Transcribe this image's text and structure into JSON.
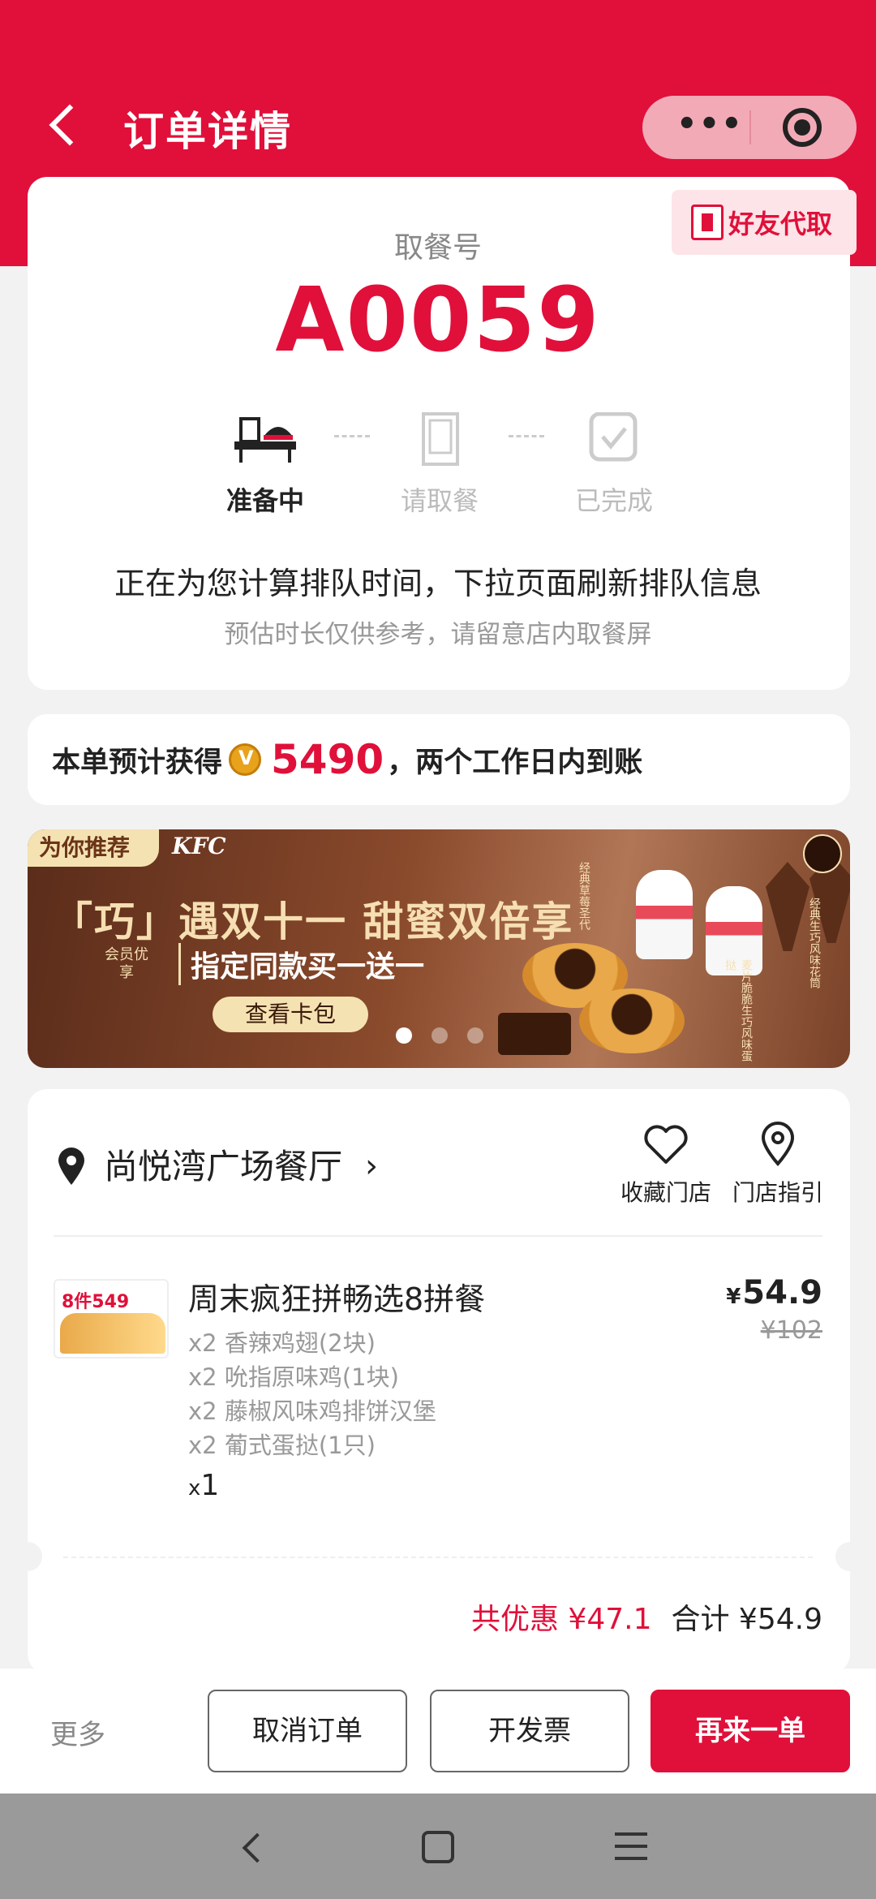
{
  "header": {
    "title": "订单详情",
    "accent_color": "#e0103a"
  },
  "friend_pickup": {
    "label": "好友代取"
  },
  "pickup": {
    "label": "取餐号",
    "number": "A0059"
  },
  "steps": [
    {
      "label": "准备中",
      "state": "active",
      "icon": "tray-burger-icon"
    },
    {
      "label": "请取餐",
      "state": "inactive",
      "icon": "kfc-bag-icon"
    },
    {
      "label": "已完成",
      "state": "inactive",
      "icon": "check-box-icon"
    }
  ],
  "queue": {
    "main": "正在为您计算排队时间，下拉页面刷新排队信息",
    "sub": "预估时长仅供参考，请留意店内取餐屏"
  },
  "points": {
    "prefix": "本单预计获得",
    "value": "5490",
    "suffix": "，两个工作日内到账"
  },
  "banner": {
    "tag": "为你推荐",
    "brand": "KFC",
    "headline": "「巧」遇双十一  甜蜜双倍享",
    "vip": "会员优享",
    "offer": "指定同款买一送一",
    "button": "查看卡包",
    "side_texts": [
      "经典草莓圣代",
      "经典生巧风味花筒",
      "麦片脆脆生巧风味蛋挞"
    ],
    "page_count": 3,
    "current_page": 1
  },
  "store": {
    "name": "尚悦湾广场餐厅",
    "actions": [
      {
        "label": "收藏门店",
        "icon": "heart-icon"
      },
      {
        "label": "门店指引",
        "icon": "location-pin-icon"
      }
    ]
  },
  "item": {
    "thumb_text": "8件549",
    "name": "周末疯狂拼畅选8拼餐",
    "currency": "¥",
    "price": "54.9",
    "original_price": "¥102",
    "sub_items": [
      "x2 香辣鸡翅(2块)",
      "x2 吮指原味鸡(1块)",
      "x2 藤椒风味鸡排饼汉堡",
      "x2 葡式蛋挞(1只)"
    ],
    "qty_prefix": "x",
    "qty": "1"
  },
  "totals": {
    "discount": "共优惠 ¥47.1",
    "total_label": "合计 ¥54.9"
  },
  "actions": {
    "more": "更多",
    "cancel": "取消订单",
    "invoice": "开发票",
    "reorder": "再来一单"
  }
}
